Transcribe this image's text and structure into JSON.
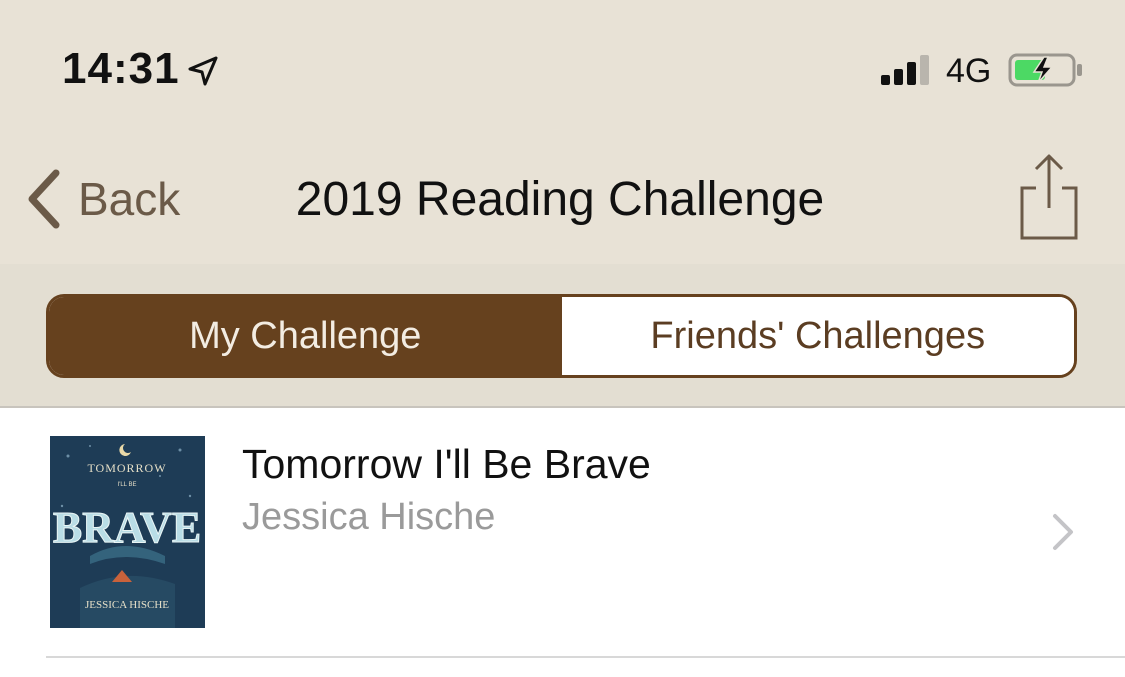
{
  "status_bar": {
    "time": "14:31",
    "location_icon": "location-arrow-icon",
    "signal_icon": "cellular-signal-icon",
    "network": "4G",
    "battery_icon": "battery-charging-icon",
    "battery_color": "#4cd964"
  },
  "nav": {
    "back_label": "Back",
    "title": "2019 Reading Challenge",
    "share_icon": "share-icon"
  },
  "segments": [
    {
      "label": "My Challenge",
      "selected": true
    },
    {
      "label": "Friends' Challenges",
      "selected": false
    }
  ],
  "books": [
    {
      "title": "Tomorrow I'll Be Brave",
      "author": "Jessica Hische",
      "cover": {
        "top_text": "TOMORROW",
        "small_text": "I'LL BE",
        "main_text": "BRAVE",
        "bottom_text": "JESSICA HISCHE"
      }
    }
  ],
  "colors": {
    "header_bg": "#e8e2d6",
    "accent_brown": "#66411e",
    "back_text": "#6b5a48",
    "author_gray": "#9a9a9a"
  }
}
